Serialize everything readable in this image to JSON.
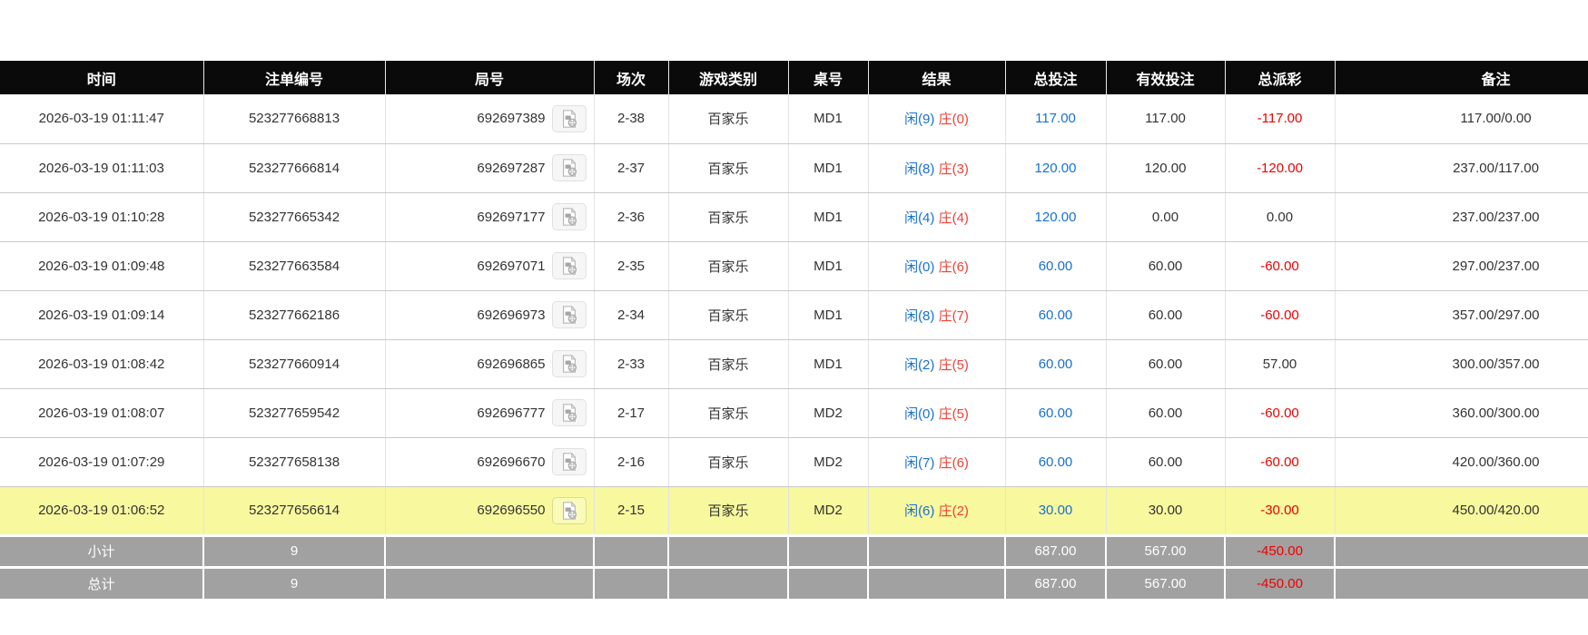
{
  "colors": {
    "header-bg": "#0a0a0a",
    "header-fg": "#ffffff",
    "text": "#333333",
    "blue": "#1770d6",
    "red": "#ee0000",
    "banker-red": "#ef4136",
    "highlight": "#f8f89e",
    "summary-bg": "#a1a1a1"
  },
  "table": {
    "columns": [
      {
        "key": "time",
        "label": "时间"
      },
      {
        "key": "bet_id",
        "label": "注单编号"
      },
      {
        "key": "round_id",
        "label": "局号"
      },
      {
        "key": "session",
        "label": "场次"
      },
      {
        "key": "game_type",
        "label": "游戏类别"
      },
      {
        "key": "table_no",
        "label": "桌号"
      },
      {
        "key": "result",
        "label": "结果"
      },
      {
        "key": "total_bet",
        "label": "总投注"
      },
      {
        "key": "valid_bet",
        "label": "有效投注"
      },
      {
        "key": "payout",
        "label": "总派彩"
      },
      {
        "key": "remark",
        "label": "备注"
      }
    ],
    "video_icon": "video-replay-icon",
    "rows": [
      {
        "time": "2026-03-19 01:11:47",
        "bet_id": "523277668813",
        "round_id": "692697389",
        "session": "2-38",
        "game_type": "百家乐",
        "table_no": "MD1",
        "result_player": "闲(9)",
        "result_banker": "庄(0)",
        "total_bet": "117.00",
        "valid_bet": "117.00",
        "payout": "-117.00",
        "remark": "117.00/0.00",
        "highlighted": false
      },
      {
        "time": "2026-03-19 01:11:03",
        "bet_id": "523277666814",
        "round_id": "692697287",
        "session": "2-37",
        "game_type": "百家乐",
        "table_no": "MD1",
        "result_player": "闲(8)",
        "result_banker": "庄(3)",
        "total_bet": "120.00",
        "valid_bet": "120.00",
        "payout": "-120.00",
        "remark": "237.00/117.00",
        "highlighted": false
      },
      {
        "time": "2026-03-19 01:10:28",
        "bet_id": "523277665342",
        "round_id": "692697177",
        "session": "2-36",
        "game_type": "百家乐",
        "table_no": "MD1",
        "result_player": "闲(4)",
        "result_banker": "庄(4)",
        "total_bet": "120.00",
        "valid_bet": "0.00",
        "payout": "0.00",
        "remark": "237.00/237.00",
        "highlighted": false
      },
      {
        "time": "2026-03-19 01:09:48",
        "bet_id": "523277663584",
        "round_id": "692697071",
        "session": "2-35",
        "game_type": "百家乐",
        "table_no": "MD1",
        "result_player": "闲(0)",
        "result_banker": "庄(6)",
        "total_bet": "60.00",
        "valid_bet": "60.00",
        "payout": "-60.00",
        "remark": "297.00/237.00",
        "highlighted": false
      },
      {
        "time": "2026-03-19 01:09:14",
        "bet_id": "523277662186",
        "round_id": "692696973",
        "session": "2-34",
        "game_type": "百家乐",
        "table_no": "MD1",
        "result_player": "闲(8)",
        "result_banker": "庄(7)",
        "total_bet": "60.00",
        "valid_bet": "60.00",
        "payout": "-60.00",
        "remark": "357.00/297.00",
        "highlighted": false
      },
      {
        "time": "2026-03-19 01:08:42",
        "bet_id": "523277660914",
        "round_id": "692696865",
        "session": "2-33",
        "game_type": "百家乐",
        "table_no": "MD1",
        "result_player": "闲(2)",
        "result_banker": "庄(5)",
        "total_bet": "60.00",
        "valid_bet": "60.00",
        "payout": "57.00",
        "remark": "300.00/357.00",
        "highlighted": false
      },
      {
        "time": "2026-03-19 01:08:07",
        "bet_id": "523277659542",
        "round_id": "692696777",
        "session": "2-17",
        "game_type": "百家乐",
        "table_no": "MD2",
        "result_player": "闲(0)",
        "result_banker": "庄(5)",
        "total_bet": "60.00",
        "valid_bet": "60.00",
        "payout": "-60.00",
        "remark": "360.00/300.00",
        "highlighted": false
      },
      {
        "time": "2026-03-19 01:07:29",
        "bet_id": "523277658138",
        "round_id": "692696670",
        "session": "2-16",
        "game_type": "百家乐",
        "table_no": "MD2",
        "result_player": "闲(7)",
        "result_banker": "庄(6)",
        "total_bet": "60.00",
        "valid_bet": "60.00",
        "payout": "-60.00",
        "remark": "420.00/360.00",
        "highlighted": false
      },
      {
        "time": "2026-03-19 01:06:52",
        "bet_id": "523277656614",
        "round_id": "692696550",
        "session": "2-15",
        "game_type": "百家乐",
        "table_no": "MD2",
        "result_player": "闲(6)",
        "result_banker": "庄(2)",
        "total_bet": "30.00",
        "valid_bet": "30.00",
        "payout": "-30.00",
        "remark": "450.00/420.00",
        "highlighted": true
      }
    ],
    "summary_rows": [
      {
        "label": "小计",
        "count": "9",
        "total_bet": "687.00",
        "valid_bet": "567.00",
        "payout": "-450.00"
      },
      {
        "label": "总计",
        "count": "9",
        "total_bet": "687.00",
        "valid_bet": "567.00",
        "payout": "-450.00"
      }
    ]
  }
}
